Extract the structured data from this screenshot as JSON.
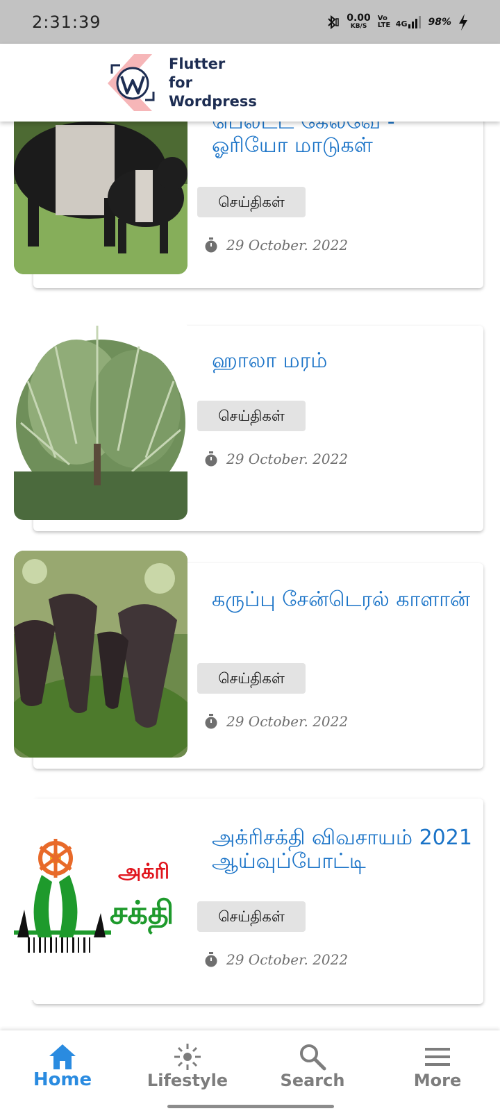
{
  "status_bar": {
    "time": "2:31:39",
    "net_speed": "0.00",
    "net_unit": "KB/S",
    "volte": "Vo LTE",
    "network": "4G",
    "battery": "98%"
  },
  "app_bar": {
    "logo_text": [
      "Flutter",
      "for",
      "Wordpress"
    ]
  },
  "articles": [
    {
      "title": "பெல்ட்ட் கேல்வே - ஓரியோ மாடுகள்",
      "category": "செய்திகள்",
      "date": "29 October. 2022"
    },
    {
      "title": "ஹாலா மரம்",
      "category": "செய்திகள்",
      "date": "29 October. 2022"
    },
    {
      "title": "கருப்பு சேன்டெரல் காளான்",
      "category": "செய்திகள்",
      "date": "29 October. 2022"
    },
    {
      "title": "அக்ரிசக்தி விவசாயம் 2021 ஆய்வுப்போட்டி",
      "category": "செய்திகள்",
      "date": "29 October. 2022"
    }
  ],
  "thumb4_logo_text": [
    "அக்ரி",
    "சக்தி"
  ],
  "bottom_nav": [
    {
      "label": "Home",
      "icon": "home-icon",
      "active": true
    },
    {
      "label": "Lifestyle",
      "icon": "lifestyle-icon",
      "active": false
    },
    {
      "label": "Search",
      "icon": "search-icon",
      "active": false
    },
    {
      "label": "More",
      "icon": "menu-icon",
      "active": false
    }
  ],
  "colors": {
    "accent": "#2a8be0",
    "title": "#1a73c7",
    "chip": "#e3e3e3",
    "status_bar": "#c2c2c2"
  }
}
